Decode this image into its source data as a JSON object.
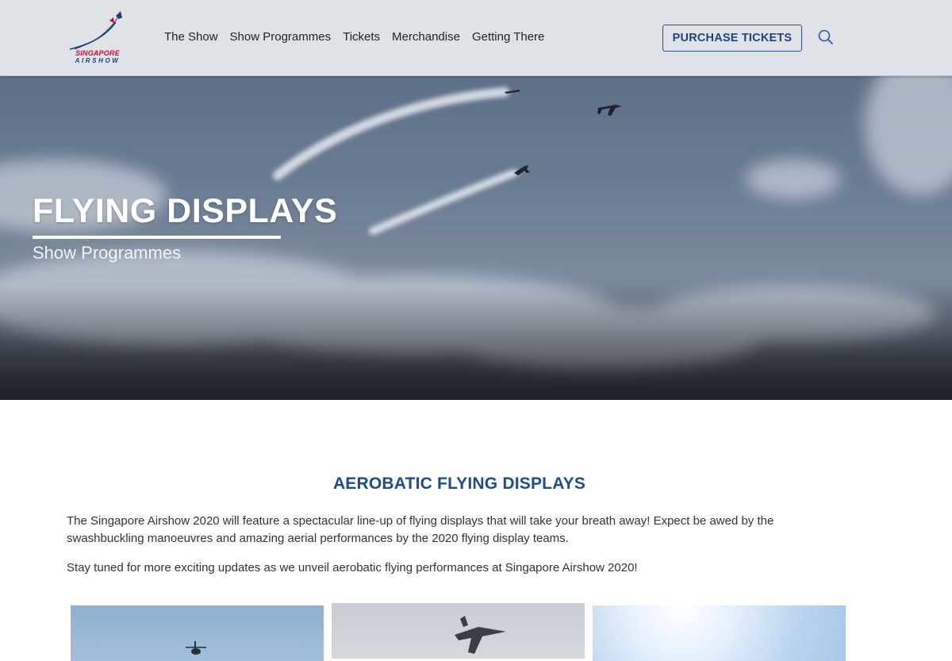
{
  "logo": {
    "line1": "SINGAPORE",
    "line2": "AIRSHOW",
    "icon": "airshow-logo-icon"
  },
  "nav": {
    "items": [
      {
        "label": "The Show"
      },
      {
        "label": "Show Programmes"
      },
      {
        "label": "Tickets"
      },
      {
        "label": "Merchandise"
      },
      {
        "label": "Getting There"
      }
    ],
    "cta_label": "PURCHASE TICKETS",
    "search_icon": "search-icon"
  },
  "hero": {
    "title": "FLYING DISPLAYS",
    "subtitle": "Show Programmes"
  },
  "content": {
    "heading": "AEROBATIC FLYING DISPLAYS",
    "paragraph1": "The Singapore Airshow 2020 will feature a spectacular line-up of flying displays that will take your breath away! Expect be awed by the swashbuckling manoeuvres and amazing aerial performances by the 2020 flying display teams.",
    "paragraph2": "Stay tuned for more exciting updates as we unveil aerobatic flying performances at Singapore Airshow 2020!"
  },
  "colors": {
    "accent_blue": "#1e4d8c",
    "logo_red": "#c8102e",
    "header_bg": "#dfe3e8"
  }
}
